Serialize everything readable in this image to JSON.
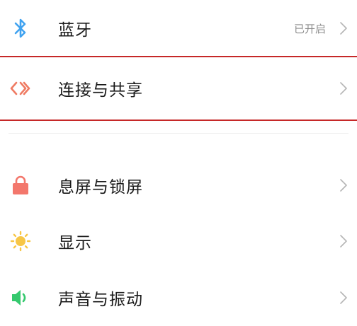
{
  "settings": {
    "items": [
      {
        "label": "蓝牙",
        "status": "已开启",
        "icon": "bluetooth-icon",
        "color": "#3fa2f0"
      },
      {
        "label": "连接与共享",
        "icon": "connection-share-icon",
        "color": "#ef7b63"
      },
      {
        "label": "息屏与锁屏",
        "icon": "lock-icon",
        "color": "#f3776c"
      },
      {
        "label": "显示",
        "icon": "sun-icon",
        "color": "#f7c646"
      },
      {
        "label": "声音与振动",
        "icon": "speaker-icon",
        "color": "#35c96e"
      }
    ]
  }
}
